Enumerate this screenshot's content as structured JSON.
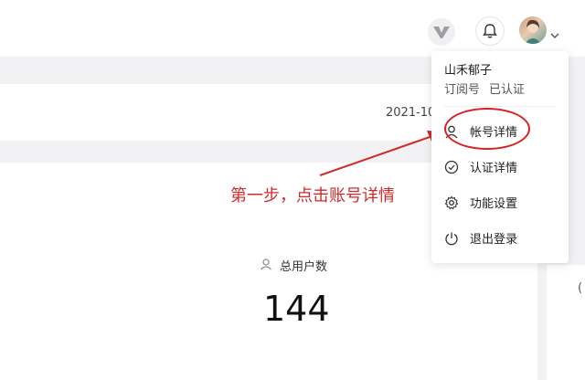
{
  "header": {
    "account_menu_icon": "chevron-down-icon",
    "bell_icon": "bell-icon",
    "logo_icon": "v-logo-icon"
  },
  "account": {
    "name": "山禾郁子",
    "type": "订阅号",
    "status": "已认证"
  },
  "menu": {
    "items": [
      {
        "label": "帐号详情",
        "icon": "user-icon"
      },
      {
        "label": "认证详情",
        "icon": "check-circle-icon"
      },
      {
        "label": "功能设置",
        "icon": "gear-icon"
      },
      {
        "label": "退出登录",
        "icon": "power-icon"
      }
    ]
  },
  "overview": {
    "date": "2021-10",
    "stat_label": "总用户数",
    "stat_value": "144"
  },
  "annotation": {
    "text": "第一步，点击账号详情",
    "color": "#d02a2a"
  },
  "side_edge_text": "("
}
